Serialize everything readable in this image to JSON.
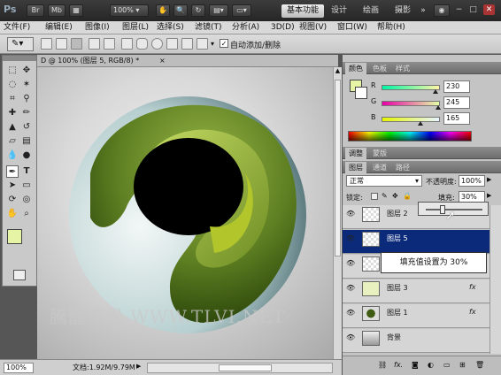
{
  "titlebar": {
    "logo": "Ps",
    "br": "Br",
    "mb": "Mb",
    "zoom": "100%",
    "workspaces": [
      "基本功能",
      "设计",
      "绘画",
      "摄影"
    ],
    "more": "»",
    "min": "−",
    "restore": "□",
    "close": "✕"
  },
  "menu": [
    "文件(F)",
    "编辑(E)",
    "图像(I)",
    "图层(L)",
    "选择(S)",
    "滤镜(T)",
    "分析(A)",
    "3D(D)",
    "视图(V)",
    "窗口(W)",
    "帮助(H)"
  ],
  "options": {
    "auto_add_label": "自动添加/删除"
  },
  "doc_tab": {
    "title": "D @ 100% (图层 5, RGB/8) *",
    "close": "×"
  },
  "status": {
    "zoom": "100%",
    "doc_info": "文档:1.92M/9.79M"
  },
  "color_panel": {
    "tabs": [
      "颜色",
      "色板",
      "样式"
    ],
    "r_label": "R",
    "g_label": "G",
    "b_label": "B",
    "r": "230",
    "g": "245",
    "b": "165",
    "r_level": 0.902,
    "g_level": 0.961,
    "b_level": 0.647,
    "fg_color": "#e6f5a5"
  },
  "adjust_tabs": [
    "调整",
    "蒙版"
  ],
  "layers_panel": {
    "tabs": [
      "图层",
      "通道",
      "路径"
    ],
    "blend_mode": "正常",
    "opacity_label": "不透明度:",
    "opacity": "100%",
    "lock_label": "锁定:",
    "fill_label": "填充:",
    "fill": "30%",
    "fill_level": 0.3,
    "layers": [
      {
        "name": "图层 2",
        "fx": "fx",
        "selected": false
      },
      {
        "name": "图层 5",
        "fx": "",
        "selected": true
      },
      {
        "name": "",
        "fx": "",
        "selected": false
      },
      {
        "name": "图层 3",
        "fx": "fx",
        "selected": false
      },
      {
        "name": "图层 1",
        "fx": "fx",
        "selected": false
      },
      {
        "name": "背景",
        "fx": "",
        "selected": false
      }
    ]
  },
  "tooltip": "填充值设置为 30%",
  "watermark": "騰龍視覺 WWW.TLVI.NET",
  "colors": {
    "accent_selection": "#0b2b7a",
    "green_dark": "#3f5d12",
    "green_light": "#b7d23a"
  }
}
